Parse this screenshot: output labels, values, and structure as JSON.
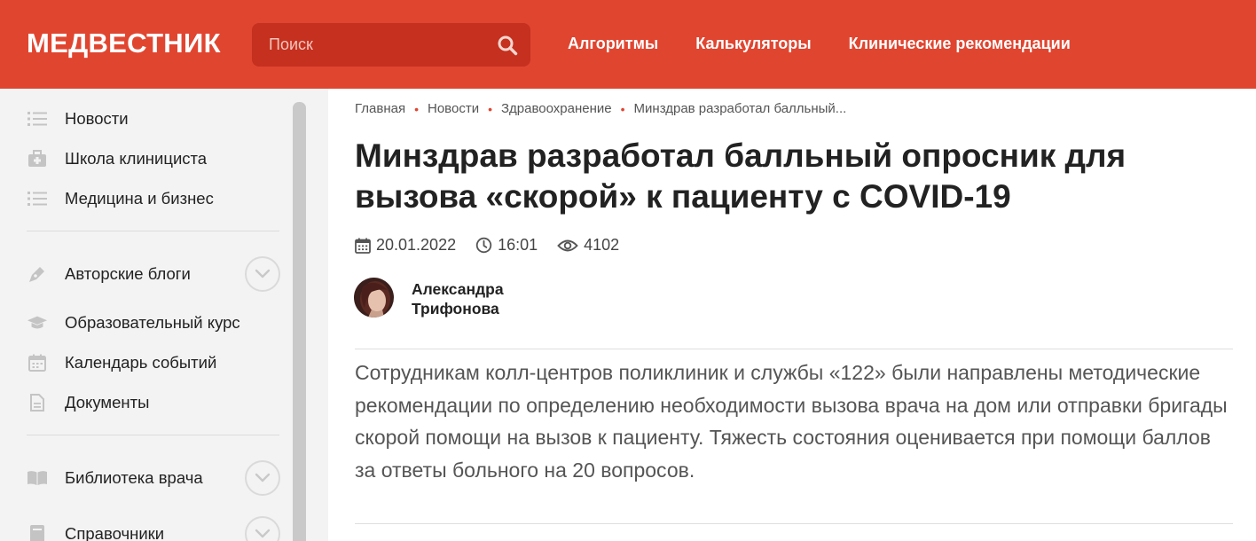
{
  "header": {
    "logo": "МЕДВЕСТНИК",
    "search": {
      "placeholder": "Поиск",
      "icon": "search-icon"
    },
    "nav": [
      {
        "label": "Алгоритмы"
      },
      {
        "label": "Калькуляторы"
      },
      {
        "label": "Клинические рекомендации"
      }
    ],
    "brand_color": "#e04530"
  },
  "sidebar": {
    "items": [
      {
        "label": "Новости",
        "icon": "list-icon"
      },
      {
        "label": "Школа клинициста",
        "icon": "briefcase-medical-icon"
      },
      {
        "label": "Медицина и бизнес",
        "icon": "list-icon"
      },
      {
        "label": "Авторские блоги",
        "icon": "pen-icon",
        "expandable": true
      },
      {
        "label": "Образовательный курс",
        "icon": "graduation-cap-icon"
      },
      {
        "label": "Календарь событий",
        "icon": "calendar-icon"
      },
      {
        "label": "Документы",
        "icon": "document-icon"
      },
      {
        "label": "Библиотека врача",
        "icon": "book-icon",
        "expandable": true
      },
      {
        "label": "Справочники",
        "icon": "handbook-icon",
        "expandable": true
      }
    ]
  },
  "breadcrumb": [
    {
      "label": "Главная"
    },
    {
      "label": "Новости"
    },
    {
      "label": "Здравоохранение"
    },
    {
      "label": "Минздрав разработал балльный..."
    }
  ],
  "article": {
    "title": "Минздрав разработал балльный опросник для вызова «скорой» к пациенту с COVID-19",
    "date": "20.01.2022",
    "time": "16:01",
    "views": "4102",
    "author": {
      "first_name": "Александра",
      "last_name": "Трифонова"
    },
    "lead": "Сотрудникам колл-центров поликлиник и службы «122» были направлены методические рекомендации по определению необходимости вызова врача на дом или отправки бригады скорой помощи на вызов к пациенту. Тяжесть состояния оценивается при помощи баллов за ответы больного на 20 вопросов."
  }
}
